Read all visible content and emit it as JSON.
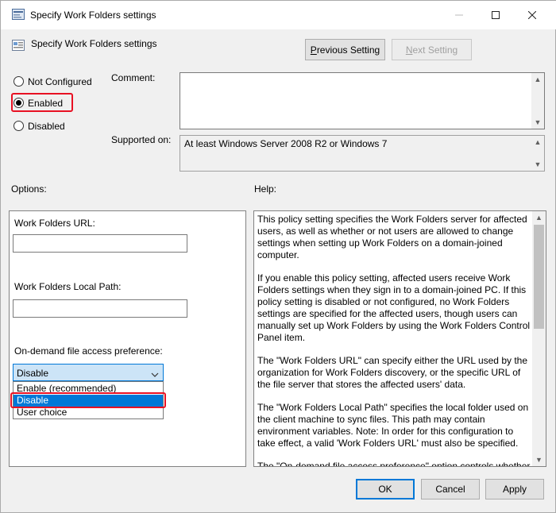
{
  "window": {
    "title": "Specify Work Folders settings",
    "header_title": "Specify Work Folders settings"
  },
  "buttons": {
    "previous_prefix": "P",
    "previous_rest": "revious Setting",
    "next_prefix": "N",
    "next_rest": "ext Setting",
    "ok": "OK",
    "cancel": "Cancel",
    "apply": "Apply"
  },
  "state": {
    "not_configured": "Not Configured",
    "enabled": "Enabled",
    "disabled": "Disabled"
  },
  "comment_label": "Comment:",
  "supported_on_label": "Supported on:",
  "supported_on_value": "At least Windows Server 2008 R2 or Windows 7",
  "options_label": "Options:",
  "help_label": "Help:",
  "options": {
    "url_label": "Work Folders URL:",
    "url_value": "",
    "path_label": "Work Folders Local Path:",
    "path_value": "",
    "ondemand_label": "On-demand file access preference:",
    "combo_value": "Disable",
    "dropdown_items": [
      "Enable (recommended)",
      "Disable",
      "User choice"
    ]
  },
  "help": {
    "paragraphs": [
      "This policy setting specifies the Work Folders server for affected users, as well as whether or not users are allowed to change settings when setting up Work Folders on a domain-joined computer.",
      "If you enable this policy setting, affected users receive Work Folders settings when they sign in to a domain-joined PC. If this policy setting is disabled or not configured, no Work Folders settings are specified for the affected users, though users can manually set up Work Folders by using the Work Folders Control Panel item.",
      "The \"Work Folders URL\" can specify either the URL used by the organization for Work Folders discovery, or the specific URL of the file server that stores the affected users' data.",
      "The \"Work Folders Local Path\" specifies the local folder used on the client machine to sync files. This path may contain environment variables. Note: In order for this configuration to take effect, a valid 'Work Folders URL' must also be specified.",
      "The \"On-demand file access preference\" option controls whether"
    ]
  },
  "colors": {
    "highlight_red": "#e81123",
    "selection_blue": "#0078d7"
  }
}
